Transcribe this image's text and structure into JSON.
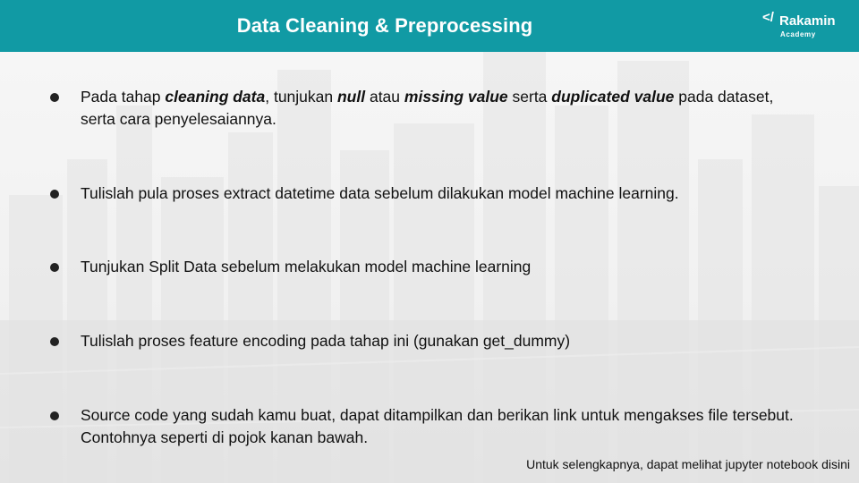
{
  "header": {
    "title": "Data Cleaning & Preprocessing",
    "accent_color": "#119aa4",
    "logo": {
      "mark": "</",
      "name": "Rakamin",
      "sub": "Academy"
    }
  },
  "bullets": [
    {
      "parts": [
        {
          "t": "Pada tahap ",
          "s": ""
        },
        {
          "t": "cleaning data",
          "s": "bi"
        },
        {
          "t": ", tunjukan ",
          "s": ""
        },
        {
          "t": "null",
          "s": "bi"
        },
        {
          "t": " atau ",
          "s": ""
        },
        {
          "t": "missing value",
          "s": "bi"
        },
        {
          "t": " serta ",
          "s": ""
        },
        {
          "t": "duplicated value",
          "s": "bi"
        },
        {
          "t": " pada dataset, serta cara penyelesaiannya.",
          "s": ""
        }
      ]
    },
    {
      "parts": [
        {
          "t": "Tulislah pula proses ",
          "s": ""
        },
        {
          "t": "extract datetime data",
          "s": "b"
        },
        {
          "t": " sebelum dilakukan model machine learning.",
          "s": ""
        }
      ]
    },
    {
      "parts": [
        {
          "t": "Tunjukan ",
          "s": ""
        },
        {
          "t": "Split Data",
          "s": "b"
        },
        {
          "t": " sebelum melakukan model machine learning",
          "s": ""
        }
      ]
    },
    {
      "parts": [
        {
          "t": "Tulislah proses ",
          "s": ""
        },
        {
          "t": "feature encoding",
          "s": "b"
        },
        {
          "t": " pada tahap ini (gunakan get_dummy)",
          "s": ""
        }
      ]
    },
    {
      "parts": [
        {
          "t": "Source code",
          "s": "b"
        },
        {
          "t": " yang sudah kamu buat, dapat ditampilkan dan berikan link untuk mengakses file tersebut. Contohnya seperti di pojok kanan bawah.",
          "s": ""
        }
      ]
    }
  ],
  "footer": {
    "note": "Untuk selengkapnya, dapat melihat jupyter notebook disini"
  }
}
